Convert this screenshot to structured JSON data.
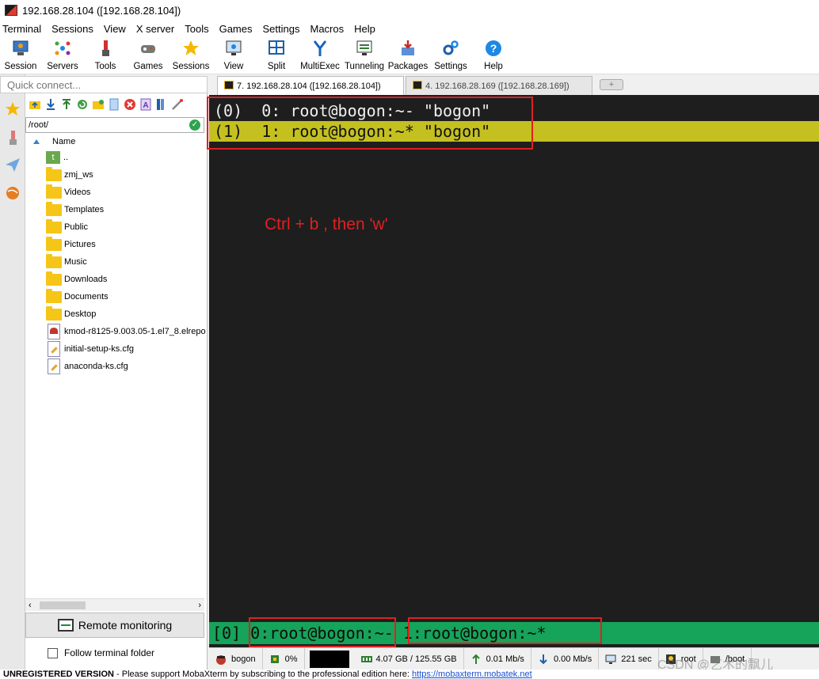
{
  "window": {
    "title": "192.168.28.104 ([192.168.28.104])"
  },
  "menu": [
    "Terminal",
    "Sessions",
    "View",
    "X server",
    "Tools",
    "Games",
    "Settings",
    "Macros",
    "Help"
  ],
  "toolbar": [
    {
      "label": "Session",
      "icon": "session-icon"
    },
    {
      "label": "Servers",
      "icon": "servers-icon"
    },
    {
      "label": "Tools",
      "icon": "tools-icon"
    },
    {
      "label": "Games",
      "icon": "games-icon"
    },
    {
      "label": "Sessions",
      "icon": "star-icon"
    },
    {
      "label": "View",
      "icon": "view-icon"
    },
    {
      "label": "Split",
      "icon": "split-icon"
    },
    {
      "label": "MultiExec",
      "icon": "multiexec-icon"
    },
    {
      "label": "Tunneling",
      "icon": "tunneling-icon"
    },
    {
      "label": "Packages",
      "icon": "packages-icon"
    },
    {
      "label": "Settings",
      "icon": "settings-icon"
    },
    {
      "label": "Help",
      "icon": "help-icon"
    }
  ],
  "quick_connect": {
    "placeholder": "Quick connect..."
  },
  "sftp": {
    "path": "/root/",
    "column_name": "Name",
    "files": [
      {
        "name": "..",
        "kind": "up"
      },
      {
        "name": "zmj_ws",
        "kind": "folder"
      },
      {
        "name": "Videos",
        "kind": "folder"
      },
      {
        "name": "Templates",
        "kind": "folder"
      },
      {
        "name": "Public",
        "kind": "folder"
      },
      {
        "name": "Pictures",
        "kind": "folder"
      },
      {
        "name": "Music",
        "kind": "folder"
      },
      {
        "name": "Downloads",
        "kind": "folder"
      },
      {
        "name": "Documents",
        "kind": "folder"
      },
      {
        "name": "Desktop",
        "kind": "folder"
      },
      {
        "name": "kmod-r8125-9.003.05-1.el7_8.elrepo",
        "kind": "rpm"
      },
      {
        "name": "initial-setup-ks.cfg",
        "kind": "cfg"
      },
      {
        "name": "anaconda-ks.cfg",
        "kind": "cfg"
      }
    ],
    "remote_monitoring": "Remote monitoring",
    "follow_folder": "Follow terminal folder"
  },
  "tabs": [
    {
      "label": "7. 192.168.28.104 ([192.168.28.104])",
      "active": true
    },
    {
      "label": "4. 192.168.28.169 ([192.168.28.169])",
      "active": false
    }
  ],
  "terminal": {
    "lines": [
      "(0)  0: root@bogon:~- \"bogon\"",
      "(1)  1: root@bogon:~* \"bogon\""
    ],
    "annotation": "Ctrl + b , then 'w'",
    "status_prefix": "[0] ",
    "status_win0": "0:root@bogon:~-",
    "status_win1": "1:root@bogon:~*"
  },
  "statusbar": {
    "host": "bogon",
    "cpu": "0%",
    "memory": "4.07 GB / 125.55 GB",
    "upload": "0.01 Mb/s",
    "download": "0.00 Mb/s",
    "uptime": "221 sec",
    "user": "root",
    "mount": "/boot"
  },
  "footer": {
    "unregistered": "UNREGISTERED VERSION",
    "message": "Please support MobaXterm by subscribing to the professional edition here:",
    "link": "https://mobaxterm.mobatek.net"
  },
  "watermark": "CSDN @艺术的飘儿",
  "colors": {
    "tmux_status": "#16a35a",
    "selected_line": "#c4c020",
    "annotation": "#e02020"
  }
}
